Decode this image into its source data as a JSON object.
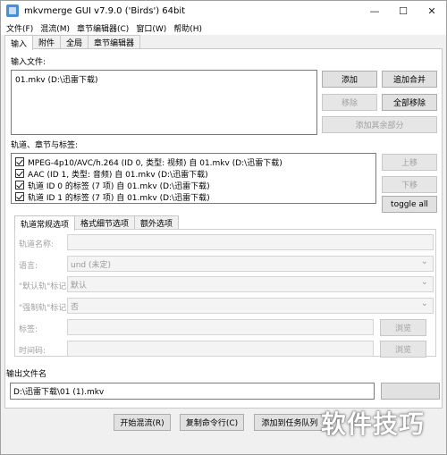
{
  "window": {
    "title": "mkvmerge GUI v7.9.0 ('Birds') 64bit",
    "minimize": "—",
    "maximize": "☐",
    "close": "✕"
  },
  "menu": [
    "文件(F)",
    "混流(M)",
    "章节编辑器(C)",
    "窗口(W)",
    "帮助(H)"
  ],
  "tabs": [
    "输入",
    "附件",
    "全局",
    "章节编辑器"
  ],
  "input": {
    "label": "输入文件:",
    "files": [
      "01.mkv (D:\\迅雷下载)"
    ],
    "buttons": {
      "add": "添加",
      "append": "追加合并",
      "remove": "移除",
      "remove_all": "全部移除",
      "add_parts": "添加其余部分"
    }
  },
  "tracks": {
    "label": "轨道、章节与标签:",
    "items": [
      "MPEG-4p10/AVC/h.264 (ID 0, 类型: 视频) 自 01.mkv (D:\\迅雷下载)",
      "AAC (ID 1, 类型: 音频) 自 01.mkv (D:\\迅雷下载)",
      "轨道 ID 0 的标签 (7 项) 自 01.mkv (D:\\迅雷下载)",
      "轨道 ID 1 的标签 (7 项) 自 01.mkv (D:\\迅雷下载)"
    ],
    "buttons": {
      "up": "上移",
      "down": "下移",
      "toggle_all": "toggle all"
    }
  },
  "subtabs": [
    "轨道常规选项",
    "格式细节选项",
    "额外选项"
  ],
  "options": {
    "track_name": {
      "label": "轨道名称:",
      "value": ""
    },
    "language": {
      "label": "语言:",
      "value": "und (未定)"
    },
    "default_track": {
      "label": "\"默认轨\"标记:",
      "value": "默认"
    },
    "forced_track": {
      "label": "\"强制轨\"标记:",
      "value": "否"
    },
    "tags": {
      "label": "标签:",
      "value": "",
      "browse": "浏览"
    },
    "timecodes": {
      "label": "时间码:",
      "value": "",
      "browse": "浏览"
    }
  },
  "output": {
    "label": "输出文件名",
    "value": "D:\\迅雷下载\\01 (1).mkv"
  },
  "actions": {
    "start": "开始混流(R)",
    "copy_cmd": "复制命令行(C)",
    "add_job": "添加到任务队列"
  },
  "watermark": "软件技巧"
}
